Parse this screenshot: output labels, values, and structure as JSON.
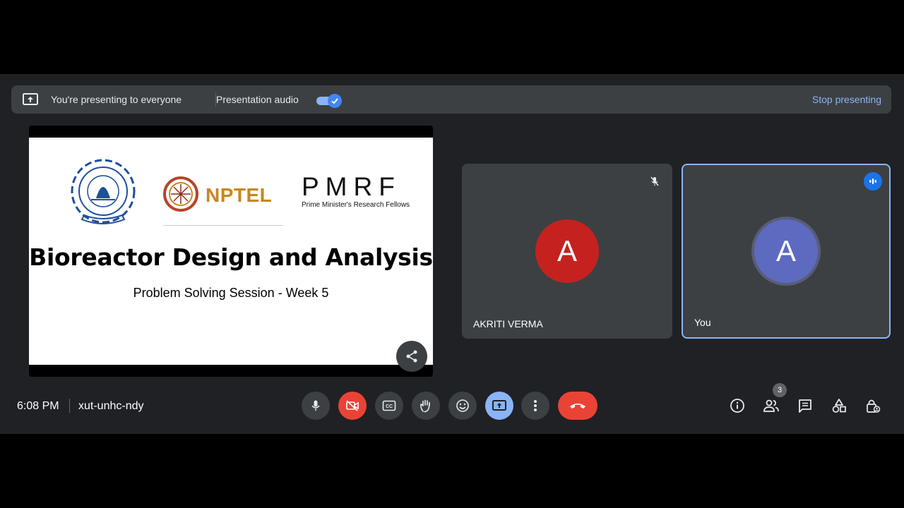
{
  "banner": {
    "presenting_text": "You're presenting to everyone",
    "audio_label": "Presentation audio",
    "audio_enabled": true,
    "stop_label": "Stop presenting"
  },
  "slide": {
    "nptel_logo_text": "NPTEL",
    "pmrf_title": "PMRF",
    "pmrf_subtitle": "Prime Minister's Research Fellows",
    "title": "Bioreactor Design and Analysis",
    "subtitle": "Problem Solving Session - Week 5"
  },
  "tiles": [
    {
      "initial": "A",
      "name": "AKRITI VERMA",
      "muted": true,
      "avatar_color": "#c5221f"
    },
    {
      "initial": "A",
      "name": "You",
      "speaking": true,
      "avatar_color": "#5c6bc0"
    }
  ],
  "meeting": {
    "time": "6:08 PM",
    "code": "xut-unhc-ndy",
    "participant_count": "3"
  },
  "colors": {
    "accent": "#8ab4f8",
    "danger": "#ea4335",
    "surface": "#3c4043",
    "background": "#202124"
  }
}
